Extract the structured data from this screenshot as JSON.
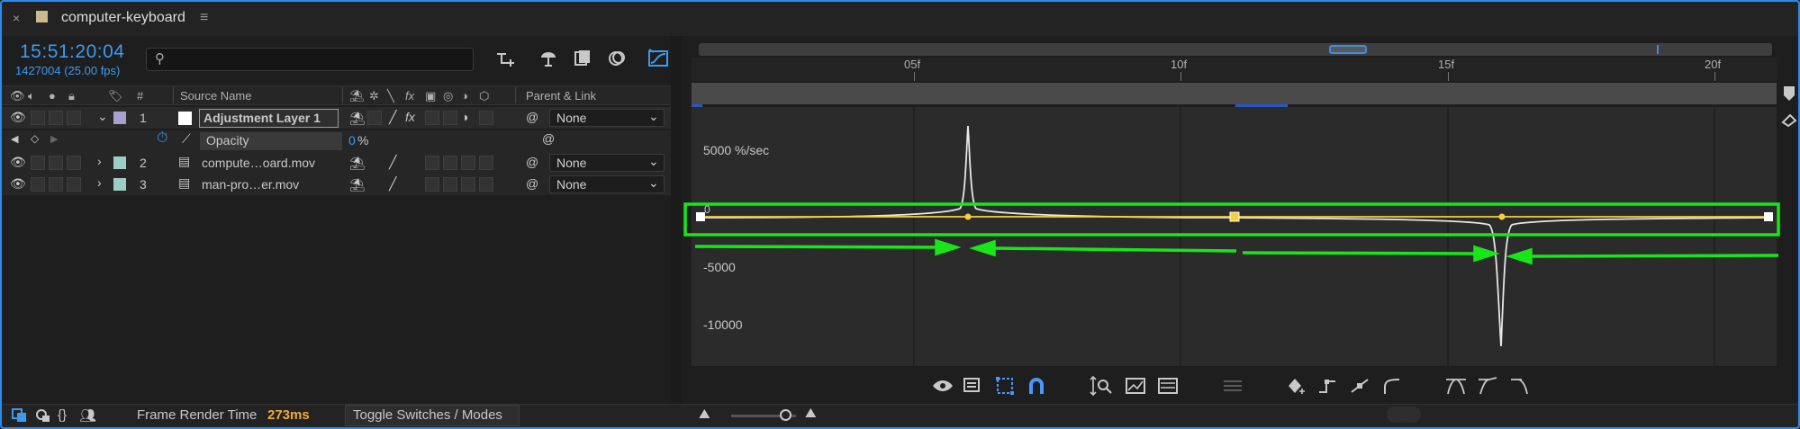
{
  "tab": {
    "title": "computer-keyboard",
    "close_glyph": "×",
    "menu_glyph": "≡",
    "swatch_color": "#c9b98f"
  },
  "comp": {
    "timecode": "15:51:20:04",
    "frames_fps": "1427004 (25.00 fps)",
    "search_placeholder": ""
  },
  "columns": {
    "hash": "#",
    "source_name": "Source Name",
    "parent_link": "Parent & Link"
  },
  "layers": [
    {
      "num": "1",
      "name": "Adjustment Layer 1",
      "swatch": "#a8a0cc",
      "parent": "None"
    },
    {
      "num": "2",
      "name": "compute…oard.mov",
      "swatch": "#9ecdc6",
      "parent": "None"
    },
    {
      "num": "3",
      "name": "man-pro…er.mov",
      "swatch": "#9ecdc6",
      "parent": "None"
    }
  ],
  "property": {
    "name": "Opacity",
    "value_num": "0",
    "value_unit": "%"
  },
  "ruler": {
    "labels": [
      "05f",
      "10f",
      "15f",
      "20f"
    ]
  },
  "graph": {
    "label_5000": "5000 %/sec",
    "label_0": "0",
    "label_m5000": "-5000",
    "label_m10000": "-10000",
    "highlight_color": "#19e619",
    "curve_color": "#f2d13b",
    "speed_color": "#e6e6e6"
  },
  "status": {
    "render_label": "Frame Render Time",
    "render_value": "273ms",
    "toggle_label": "Toggle Switches / Modes"
  }
}
